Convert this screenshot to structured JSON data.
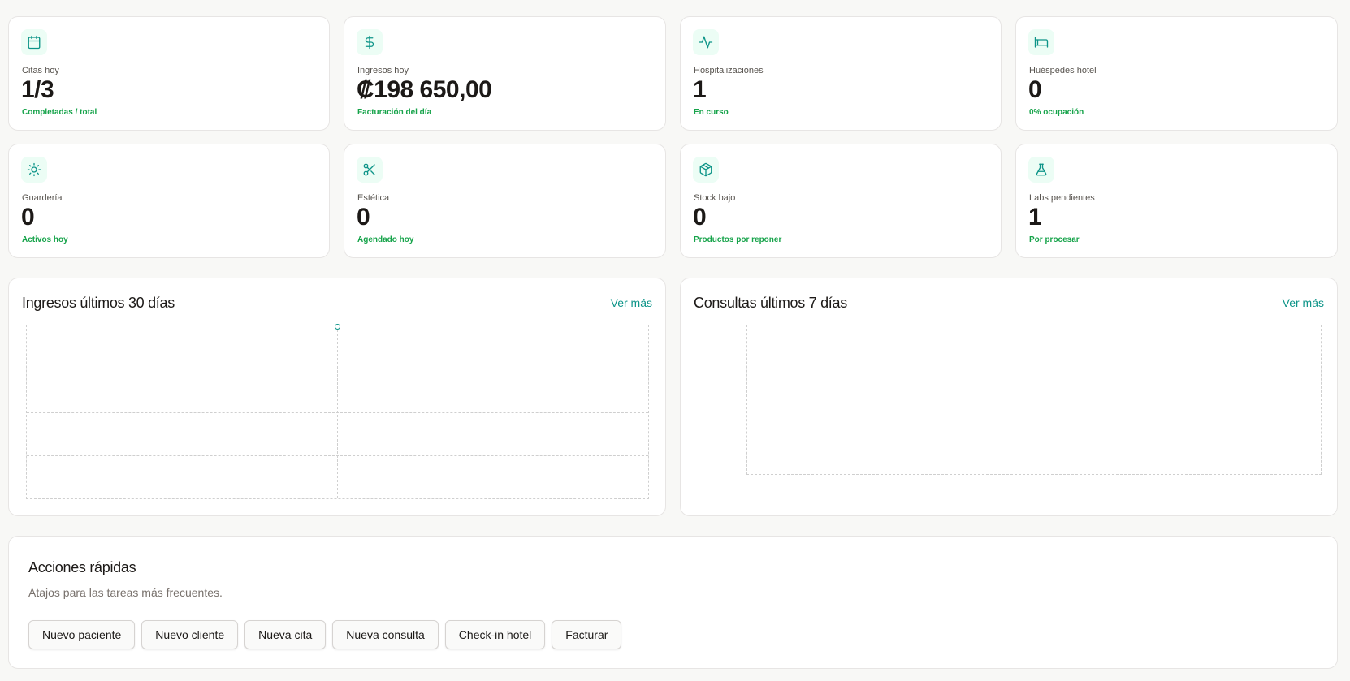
{
  "stats": [
    {
      "icon": "calendar-icon",
      "label": "Citas hoy",
      "value": "1/3",
      "sub": "Completadas / total"
    },
    {
      "icon": "dollar-icon",
      "label": "Ingresos hoy",
      "value": "₡198 650,00",
      "sub": "Facturación del día"
    },
    {
      "icon": "activity-icon",
      "label": "Hospitalizaciones",
      "value": "1",
      "sub": "En curso"
    },
    {
      "icon": "bed-icon",
      "label": "Huéspedes hotel",
      "value": "0",
      "sub": "0% ocupación"
    },
    {
      "icon": "sun-icon",
      "label": "Guardería",
      "value": "0",
      "sub": "Activos hoy"
    },
    {
      "icon": "scissors-icon",
      "label": "Estética",
      "value": "0",
      "sub": "Agendado hoy"
    },
    {
      "icon": "package-icon",
      "label": "Stock bajo",
      "value": "0",
      "sub": "Productos por reponer"
    },
    {
      "icon": "flask-icon",
      "label": "Labs pendientes",
      "value": "1",
      "sub": "Por procesar"
    }
  ],
  "charts": {
    "income": {
      "title": "Ingresos últimos 30 días",
      "link": "Ver más"
    },
    "consults": {
      "title": "Consultas últimos 7 días",
      "link": "Ver más"
    }
  },
  "quick_actions": {
    "title": "Acciones rápidas",
    "description": "Atajos para las tareas más frecuentes.",
    "buttons": [
      "Nuevo paciente",
      "Nuevo cliente",
      "Nueva cita",
      "Nueva consulta",
      "Check-in hotel",
      "Facturar"
    ]
  },
  "colors": {
    "accent": "#0d9488",
    "positive": "#16a34a",
    "icon_bg": "#ecfdf5"
  }
}
